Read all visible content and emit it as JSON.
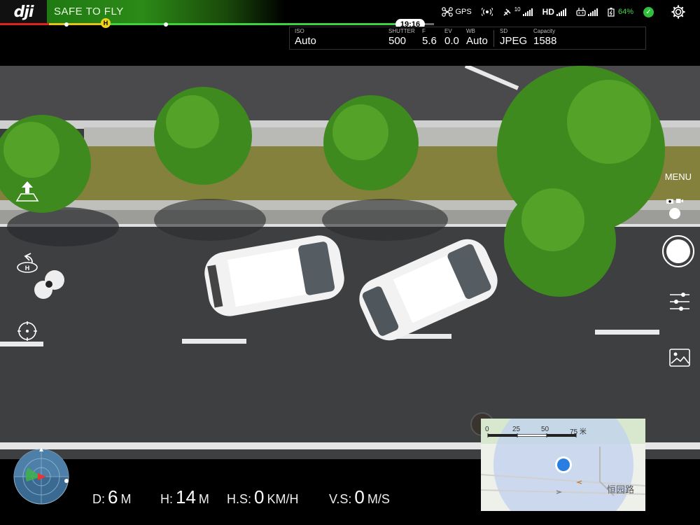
{
  "app": {
    "logo_text": "dji"
  },
  "status": {
    "flight_status": "SAFE TO FLY",
    "flight_status_color": "#2c8a17"
  },
  "top_icons": {
    "gps_label": "GPS",
    "satellite_count": "10",
    "hd_label": "HD",
    "battery_percent": "64%",
    "battery_color": "#4ad24a"
  },
  "timebar": {
    "remaining_time": "19:16",
    "home_marker": "H"
  },
  "camera": {
    "iso_label": "ISO",
    "iso_value": "Auto",
    "shutter_label": "SHUTTER",
    "shutter_value": "500",
    "f_label": "F",
    "f_value": "5.6",
    "ev_label": "EV",
    "ev_value": "0.0",
    "wb_label": "WB",
    "wb_value": "Auto",
    "sd_label": "SD",
    "sd_value": "JPEG",
    "capacity_label": "Capacity",
    "capacity_value": "1588"
  },
  "right_panel": {
    "menu_label": "MENU"
  },
  "telemetry": {
    "distance": {
      "label": "D:",
      "value": "6",
      "unit": "M"
    },
    "height": {
      "label": "H:",
      "value": "14",
      "unit": "M"
    },
    "hspeed": {
      "label": "H.S:",
      "value": "0",
      "unit": "KM/H"
    },
    "vspeed": {
      "label": "V.S:",
      "value": "0",
      "unit": "M/S"
    }
  },
  "map": {
    "scale": [
      "0",
      "25",
      "50",
      "75 米"
    ],
    "road_label": "恒园路"
  },
  "icons": [
    "dji-logo",
    "aircraft-icon",
    "signal-icon",
    "satellite-icon",
    "remote-icon",
    "battery-icon",
    "ok-icon",
    "gear-icon",
    "takeoff-icon",
    "return-home-icon",
    "poi-icon",
    "camera-icon",
    "video-icon",
    "shutter-icon",
    "settings-sliders-icon",
    "gallery-icon",
    "radar-icon"
  ]
}
